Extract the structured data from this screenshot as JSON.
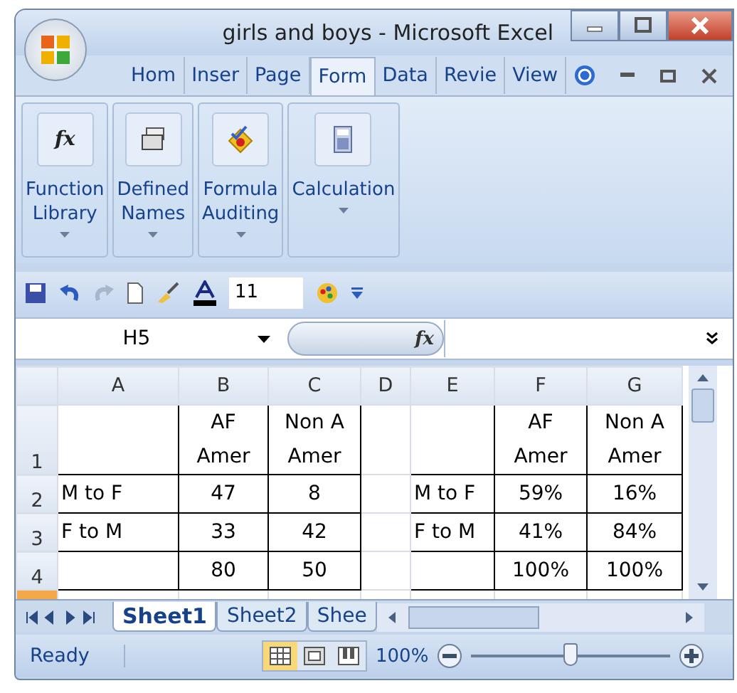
{
  "window": {
    "title": "girls and boys - Microsoft Excel"
  },
  "ribbon": {
    "tabs": [
      {
        "label": "Hom",
        "selected": false
      },
      {
        "label": "Inser",
        "selected": false
      },
      {
        "label": "Page",
        "selected": false
      },
      {
        "label": "Form",
        "selected": true
      },
      {
        "label": "Data",
        "selected": false
      },
      {
        "label": "Revie",
        "selected": false
      },
      {
        "label": "View",
        "selected": false
      }
    ],
    "groups": [
      {
        "kind": "function",
        "symbol": "fx",
        "lines": [
          "Function",
          "Library"
        ]
      },
      {
        "kind": "names",
        "lines": [
          "Defined",
          "Names"
        ]
      },
      {
        "kind": "auditing",
        "lines": [
          "Formula",
          "Auditing"
        ]
      },
      {
        "kind": "calculation",
        "lines": [
          "Calculation"
        ]
      }
    ]
  },
  "toolbar": {
    "font_size": "11"
  },
  "name_box": "H5",
  "formula_bar": {
    "symbol": "fx"
  },
  "sheet": {
    "columns": [
      "A",
      "B",
      "C",
      "D",
      "E",
      "F",
      "G"
    ],
    "rows": [
      {
        "header": "1",
        "cells": [
          "",
          "AF\nAmer",
          "Non A\nAmer",
          "",
          "",
          "AF\nAmer",
          "Non A\nAmer"
        ]
      },
      {
        "header": "2",
        "cells": [
          "M to F",
          "47",
          "8",
          "",
          "M to F",
          "59%",
          "16%"
        ]
      },
      {
        "header": "3",
        "cells": [
          "F to M",
          "33",
          "42",
          "",
          "F to M",
          "41%",
          "84%"
        ]
      },
      {
        "header": "4",
        "cells": [
          "",
          "80",
          "50",
          "",
          "",
          "100%",
          "100%"
        ]
      }
    ]
  },
  "sheet_tabs": [
    {
      "label": "Sheet1",
      "selected": true
    },
    {
      "label": "Sheet2",
      "selected": false
    },
    {
      "label": "Shee",
      "selected": false
    }
  ],
  "status_bar": {
    "status": "Ready",
    "zoom": "100%",
    "zoom_slider": {
      "level": 0.5
    }
  }
}
